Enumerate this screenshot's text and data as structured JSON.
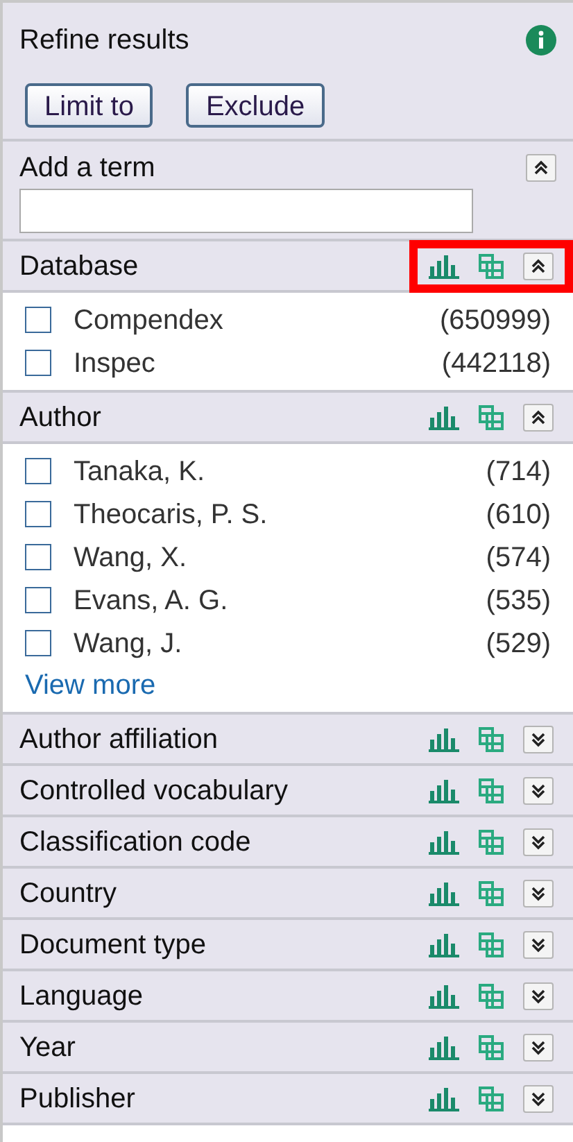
{
  "title": "Refine results",
  "buttons": [
    "Limit to",
    "Exclude"
  ],
  "add_term": {
    "label": "Add a term",
    "expanded": true
  },
  "facets": [
    {
      "label": "Database",
      "expanded": true,
      "highlighted": true,
      "items": [
        {
          "label": "Compendex",
          "count": "(650999)",
          "checked": false
        },
        {
          "label": "Inspec",
          "count": "(442118)",
          "checked": false
        }
      ]
    },
    {
      "label": "Author",
      "expanded": true,
      "highlighted": false,
      "items": [
        {
          "label": "Tanaka, K.",
          "count": "(714)",
          "checked": false
        },
        {
          "label": "Theocaris, P. S.",
          "count": "(610)",
          "checked": false
        },
        {
          "label": "Wang, X.",
          "count": "(574)",
          "checked": false
        },
        {
          "label": "Evans, A. G.",
          "count": "(535)",
          "checked": false
        },
        {
          "label": "Wang, J.",
          "count": "(529)",
          "checked": false
        }
      ],
      "more": "View more"
    },
    {
      "label": "Author affiliation",
      "expanded": false,
      "highlighted": false
    },
    {
      "label": "Controlled vocabulary",
      "expanded": false,
      "highlighted": false
    },
    {
      "label": "Classification code",
      "expanded": false,
      "highlighted": false
    },
    {
      "label": "Country",
      "expanded": false,
      "highlighted": false
    },
    {
      "label": "Document type",
      "expanded": false,
      "highlighted": false
    },
    {
      "label": "Language",
      "expanded": false,
      "highlighted": false
    },
    {
      "label": "Year",
      "expanded": false,
      "highlighted": false
    },
    {
      "label": "Publisher",
      "expanded": false,
      "highlighted": false
    }
  ]
}
